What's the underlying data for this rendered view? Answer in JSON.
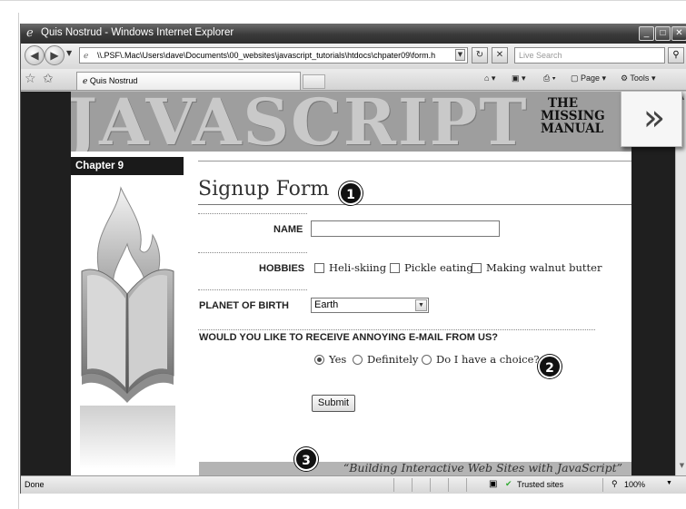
{
  "window": {
    "title": "Quis Nostrud - Windows Internet Explorer",
    "ie_icon": "ie-icon",
    "minimize": "_",
    "maximize": "□",
    "close": "✕"
  },
  "toolbar": {
    "address": "\\\\.PSF\\.Mac\\Users\\dave\\Documents\\00_websites\\javascript_tutorials\\htdocs\\chpater09\\form.h",
    "search_placeholder": "Live Search",
    "tab_title": "Quis Nostrud",
    "page_label": "Page",
    "tools_label": "Tools"
  },
  "banner": {
    "big_text": "JAVASCRIPT",
    "missing_line1": "THE",
    "missing_line2": "MISSING",
    "missing_line3": "MANUAL"
  },
  "sidebar": {
    "chapter": "Chapter 9"
  },
  "form": {
    "heading": "Signup Form",
    "name_label": "NAME",
    "name_value": "",
    "hobbies_label": "HOBBIES",
    "hobbies": [
      "Heli-skiing",
      "Pickle eating",
      "Making walnut butter"
    ],
    "planet_label": "PLANET OF BIRTH",
    "planet_value": "Earth",
    "email_question": "WOULD YOU LIKE TO RECEIVE ANNOYING E-MAIL FROM US?",
    "email_options": [
      "Yes",
      "Definitely",
      "Do I have a choice?"
    ],
    "email_selected": "Yes",
    "submit_label": "Submit"
  },
  "footer": {
    "tagline": "“Building Interactive Web Sites with JavaScript”"
  },
  "callouts": [
    "1",
    "2",
    "3"
  ],
  "overlay": {
    "arrow": "»"
  },
  "statusbar": {
    "status": "Done",
    "zone": "Trusted sites",
    "zoom": "100%"
  }
}
